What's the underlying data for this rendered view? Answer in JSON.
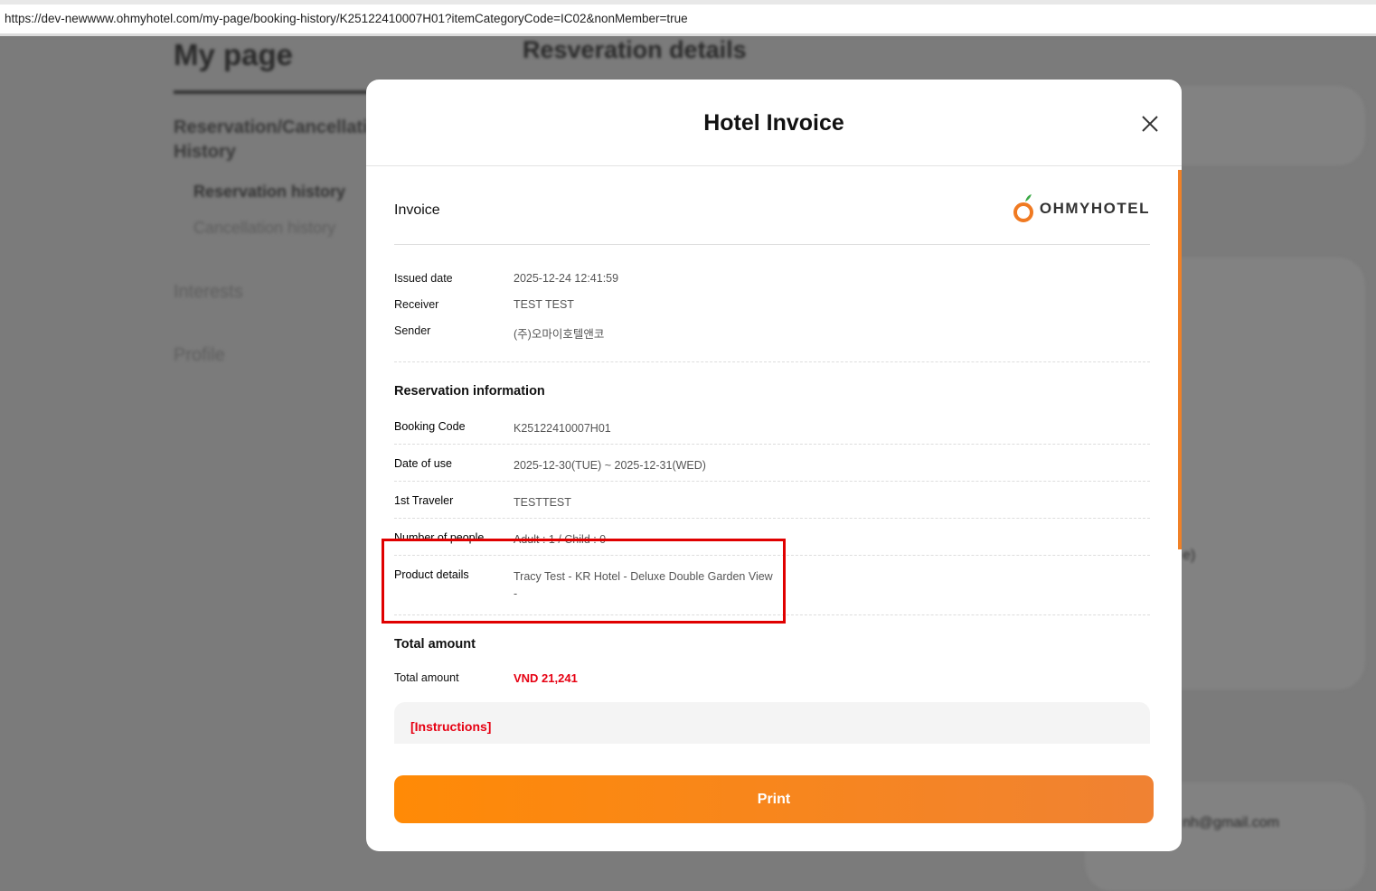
{
  "browser": {
    "url": "https://dev-newwww.ohmyhotel.com/my-page/booking-history/K25122410007H01?itemCategoryCode=IC02&nonMember=true"
  },
  "background": {
    "title": "My page",
    "section_title": "Resveration details",
    "nav": {
      "group": "Reservation/Cancellation History",
      "reservation_history": "Reservation history",
      "cancellation_history": "Cancellation history",
      "interests": "Interests",
      "profile": "Profile"
    },
    "partial_text": "e)",
    "email_partial": "nh@gmail.com"
  },
  "modal": {
    "title": "Hotel Invoice",
    "invoice_heading": "Invoice",
    "logo_text": "OHMYHOTEL",
    "issue": [
      {
        "label": "Issued date",
        "value": "2025-12-24 12:41:59"
      },
      {
        "label": "Receiver",
        "value": "TEST TEST"
      },
      {
        "label": "Sender",
        "value": "(주)오마이호텔앤코"
      }
    ],
    "reservation_heading": "Reservation information",
    "reservation": [
      {
        "label": "Booking Code",
        "value": "K25122410007H01"
      },
      {
        "label": "Date of use",
        "value": "2025-12-30(TUE) ~ 2025-12-31(WED)"
      },
      {
        "label": "1st Traveler",
        "value": "TESTTEST"
      },
      {
        "label": "Number of people",
        "value": "Adult : 1 / Child : 0"
      }
    ],
    "product": {
      "label": "Product details",
      "value": "Tracy Test - KR Hotel - Deluxe Double Garden View",
      "value2": "-"
    },
    "total_heading": "Total amount",
    "total_label": "Total amount",
    "total_value": "VND 21,241",
    "instructions": "[Instructions]",
    "print_label": "Print"
  },
  "colors": {
    "accent": "#f08127",
    "price": "#e60012",
    "highlight": "#e00000"
  }
}
